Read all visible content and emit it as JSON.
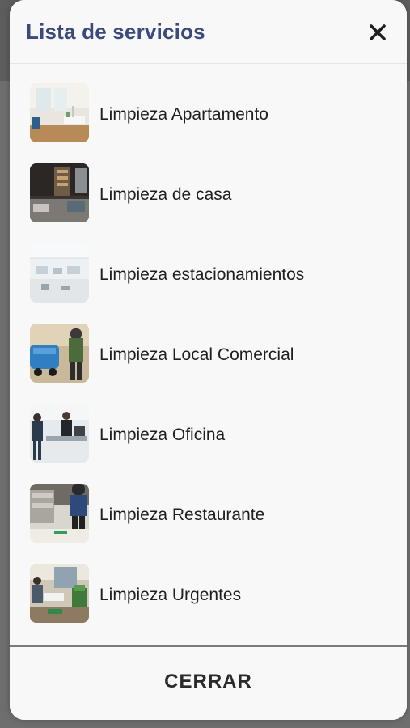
{
  "modal": {
    "title": "Lista de servicios",
    "close_icon": "close-icon",
    "footer_button_label": "CERRAR"
  },
  "services": [
    {
      "label": "Limpieza Apartamento",
      "thumbnail": "apartment-photo"
    },
    {
      "label": "Limpieza de casa",
      "thumbnail": "house-photo"
    },
    {
      "label": "Limpieza estacionamientos",
      "thumbnail": "parking-photo"
    },
    {
      "label": "Limpieza Local Comercial",
      "thumbnail": "commercial-store-photo"
    },
    {
      "label": "Limpieza Oficina",
      "thumbnail": "office-photo"
    },
    {
      "label": "Limpieza Restaurante",
      "thumbnail": "restaurant-photo"
    },
    {
      "label": "Limpieza Urgentes",
      "thumbnail": "urgent-cleaning-photo"
    }
  ],
  "colors": {
    "title": "#3b4a7e",
    "modal_background": "#f8f8f8",
    "text": "#1f1f1f"
  }
}
